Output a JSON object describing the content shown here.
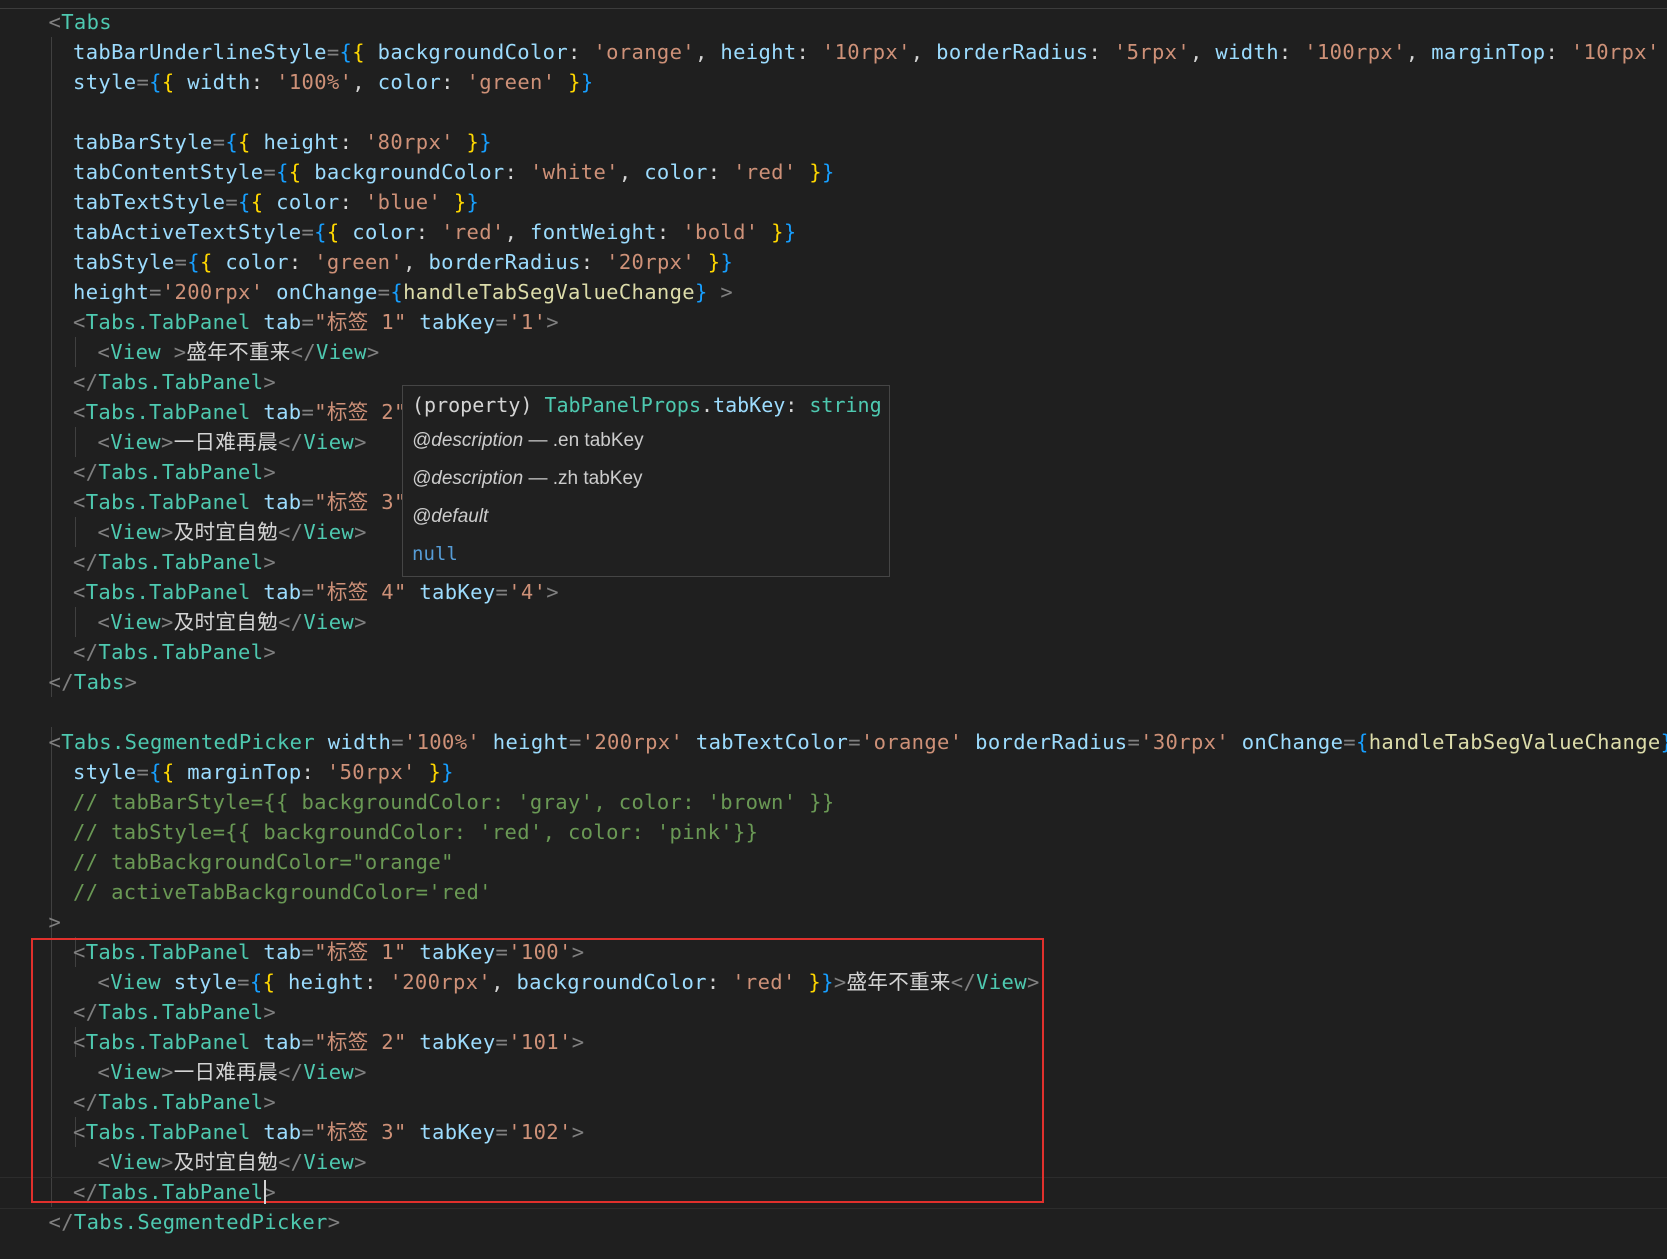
{
  "editor": {
    "lines": [
      [
        [
          "punct",
          "<"
        ],
        [
          "tag",
          "Tabs"
        ]
      ],
      [
        [
          "attr",
          "tabBarUnderlineStyle"
        ],
        [
          "punct",
          "="
        ],
        [
          "brace3",
          "{"
        ],
        [
          "brace",
          "{"
        ],
        [
          "plain",
          " "
        ],
        [
          "attr",
          "backgroundColor"
        ],
        [
          "plain",
          ": "
        ],
        [
          "str",
          "'orange'"
        ],
        [
          "plain",
          ", "
        ],
        [
          "attr",
          "height"
        ],
        [
          "plain",
          ": "
        ],
        [
          "str",
          "'10rpx'"
        ],
        [
          "plain",
          ", "
        ],
        [
          "attr",
          "borderRadius"
        ],
        [
          "plain",
          ": "
        ],
        [
          "str",
          "'5rpx'"
        ],
        [
          "plain",
          ", "
        ],
        [
          "attr",
          "width"
        ],
        [
          "plain",
          ": "
        ],
        [
          "str",
          "'100rpx'"
        ],
        [
          "plain",
          ", "
        ],
        [
          "attr",
          "marginTop"
        ],
        [
          "plain",
          ": "
        ],
        [
          "str",
          "'10rpx'"
        ],
        [
          "plain",
          " "
        ],
        [
          "brace",
          "}"
        ],
        [
          "brace3",
          "}"
        ]
      ],
      [
        [
          "attr",
          "style"
        ],
        [
          "punct",
          "="
        ],
        [
          "brace3",
          "{"
        ],
        [
          "brace",
          "{"
        ],
        [
          "plain",
          " "
        ],
        [
          "attr",
          "width"
        ],
        [
          "plain",
          ": "
        ],
        [
          "str",
          "'100%'"
        ],
        [
          "plain",
          ", "
        ],
        [
          "attr",
          "color"
        ],
        [
          "plain",
          ": "
        ],
        [
          "str",
          "'green'"
        ],
        [
          "plain",
          " "
        ],
        [
          "brace",
          "}"
        ],
        [
          "brace3",
          "}"
        ]
      ],
      [],
      [
        [
          "attr",
          "tabBarStyle"
        ],
        [
          "punct",
          "="
        ],
        [
          "brace3",
          "{"
        ],
        [
          "brace",
          "{"
        ],
        [
          "plain",
          " "
        ],
        [
          "attr",
          "height"
        ],
        [
          "plain",
          ": "
        ],
        [
          "str",
          "'80rpx'"
        ],
        [
          "plain",
          " "
        ],
        [
          "brace",
          "}"
        ],
        [
          "brace3",
          "}"
        ]
      ],
      [
        [
          "attr",
          "tabContentStyle"
        ],
        [
          "punct",
          "="
        ],
        [
          "brace3",
          "{"
        ],
        [
          "brace",
          "{"
        ],
        [
          "plain",
          " "
        ],
        [
          "attr",
          "backgroundColor"
        ],
        [
          "plain",
          ": "
        ],
        [
          "str",
          "'white'"
        ],
        [
          "plain",
          ", "
        ],
        [
          "attr",
          "color"
        ],
        [
          "plain",
          ": "
        ],
        [
          "str",
          "'red'"
        ],
        [
          "plain",
          " "
        ],
        [
          "brace",
          "}"
        ],
        [
          "brace3",
          "}"
        ]
      ],
      [
        [
          "attr",
          "tabTextStyle"
        ],
        [
          "punct",
          "="
        ],
        [
          "brace3",
          "{"
        ],
        [
          "brace",
          "{"
        ],
        [
          "plain",
          " "
        ],
        [
          "attr",
          "color"
        ],
        [
          "plain",
          ": "
        ],
        [
          "str",
          "'blue'"
        ],
        [
          "plain",
          " "
        ],
        [
          "brace",
          "}"
        ],
        [
          "brace3",
          "}"
        ]
      ],
      [
        [
          "attr",
          "tabActiveTextStyle"
        ],
        [
          "punct",
          "="
        ],
        [
          "brace3",
          "{"
        ],
        [
          "brace",
          "{"
        ],
        [
          "plain",
          " "
        ],
        [
          "attr",
          "color"
        ],
        [
          "plain",
          ": "
        ],
        [
          "str",
          "'red'"
        ],
        [
          "plain",
          ", "
        ],
        [
          "attr",
          "fontWeight"
        ],
        [
          "plain",
          ": "
        ],
        [
          "str",
          "'bold'"
        ],
        [
          "plain",
          " "
        ],
        [
          "brace",
          "}"
        ],
        [
          "brace3",
          "}"
        ]
      ],
      [
        [
          "attr",
          "tabStyle"
        ],
        [
          "punct",
          "="
        ],
        [
          "brace3",
          "{"
        ],
        [
          "brace",
          "{"
        ],
        [
          "plain",
          " "
        ],
        [
          "attr",
          "color"
        ],
        [
          "plain",
          ": "
        ],
        [
          "str",
          "'green'"
        ],
        [
          "plain",
          ", "
        ],
        [
          "attr",
          "borderRadius"
        ],
        [
          "plain",
          ": "
        ],
        [
          "str",
          "'20rpx'"
        ],
        [
          "plain",
          " "
        ],
        [
          "brace",
          "}"
        ],
        [
          "brace3",
          "}"
        ]
      ],
      [
        [
          "attr",
          "height"
        ],
        [
          "punct",
          "="
        ],
        [
          "str",
          "'200rpx'"
        ],
        [
          "plain",
          " "
        ],
        [
          "attr",
          "onChange"
        ],
        [
          "punct",
          "="
        ],
        [
          "brace3",
          "{"
        ],
        [
          "fn",
          "handleTabSegValueChange"
        ],
        [
          "brace3",
          "}"
        ],
        [
          "plain",
          " "
        ],
        [
          "punct",
          ">"
        ]
      ],
      [
        [
          "punct",
          "<"
        ],
        [
          "tag",
          "Tabs.TabPanel"
        ],
        [
          "plain",
          " "
        ],
        [
          "attr",
          "tab"
        ],
        [
          "punct",
          "="
        ],
        [
          "str",
          "\"标签 1\""
        ],
        [
          "plain",
          " "
        ],
        [
          "attr",
          "tabKey"
        ],
        [
          "punct",
          "="
        ],
        [
          "str",
          "'1'"
        ],
        [
          "punct",
          ">"
        ]
      ],
      [
        [
          "punct",
          "<"
        ],
        [
          "tag",
          "View"
        ],
        [
          "plain",
          " "
        ],
        [
          "punct",
          ">"
        ],
        [
          "text",
          "盛年不重来"
        ],
        [
          "punct",
          "</"
        ],
        [
          "tag",
          "View"
        ],
        [
          "punct",
          ">"
        ]
      ],
      [
        [
          "punct",
          "</"
        ],
        [
          "tag",
          "Tabs.TabPanel"
        ],
        [
          "punct",
          ">"
        ]
      ],
      [
        [
          "punct",
          "<"
        ],
        [
          "tag",
          "Tabs.TabPanel"
        ],
        [
          "plain",
          " "
        ],
        [
          "attr",
          "tab"
        ],
        [
          "punct",
          "="
        ],
        [
          "str",
          "\"标签 2\""
        ]
      ],
      [
        [
          "punct",
          "<"
        ],
        [
          "tag",
          "View"
        ],
        [
          "punct",
          ">"
        ],
        [
          "text",
          "一日难再晨"
        ],
        [
          "punct",
          "</"
        ],
        [
          "tag",
          "View"
        ],
        [
          "punct",
          ">"
        ]
      ],
      [
        [
          "punct",
          "</"
        ],
        [
          "tag",
          "Tabs.TabPanel"
        ],
        [
          "punct",
          ">"
        ]
      ],
      [
        [
          "punct",
          "<"
        ],
        [
          "tag",
          "Tabs.TabPanel"
        ],
        [
          "plain",
          " "
        ],
        [
          "attr",
          "tab"
        ],
        [
          "punct",
          "="
        ],
        [
          "str",
          "\"标签 3\""
        ]
      ],
      [
        [
          "punct",
          "<"
        ],
        [
          "tag",
          "View"
        ],
        [
          "punct",
          ">"
        ],
        [
          "text",
          "及时宜自勉"
        ],
        [
          "punct",
          "</"
        ],
        [
          "tag",
          "View"
        ],
        [
          "punct",
          ">"
        ]
      ],
      [
        [
          "punct",
          "</"
        ],
        [
          "tag",
          "Tabs.TabPanel"
        ],
        [
          "punct",
          ">"
        ]
      ],
      [
        [
          "punct",
          "<"
        ],
        [
          "tag",
          "Tabs.TabPanel"
        ],
        [
          "plain",
          " "
        ],
        [
          "attr",
          "tab"
        ],
        [
          "punct",
          "="
        ],
        [
          "str",
          "\"标签 4\""
        ],
        [
          "plain",
          " "
        ],
        [
          "attr",
          "tabKey"
        ],
        [
          "punct",
          "="
        ],
        [
          "str",
          "'4'"
        ],
        [
          "punct",
          ">"
        ]
      ],
      [
        [
          "punct",
          "<"
        ],
        [
          "tag",
          "View"
        ],
        [
          "punct",
          ">"
        ],
        [
          "text",
          "及时宜自勉"
        ],
        [
          "punct",
          "</"
        ],
        [
          "tag",
          "View"
        ],
        [
          "punct",
          ">"
        ]
      ],
      [
        [
          "punct",
          "</"
        ],
        [
          "tag",
          "Tabs.TabPanel"
        ],
        [
          "punct",
          ">"
        ]
      ],
      [
        [
          "punct",
          "</"
        ],
        [
          "tag",
          "Tabs"
        ],
        [
          "punct",
          ">"
        ]
      ],
      [],
      [
        [
          "punct",
          "<"
        ],
        [
          "tag",
          "Tabs.SegmentedPicker"
        ],
        [
          "plain",
          " "
        ],
        [
          "attr",
          "width"
        ],
        [
          "punct",
          "="
        ],
        [
          "str",
          "'100%'"
        ],
        [
          "plain",
          " "
        ],
        [
          "attr",
          "height"
        ],
        [
          "punct",
          "="
        ],
        [
          "str",
          "'200rpx'"
        ],
        [
          "plain",
          " "
        ],
        [
          "attr",
          "tabTextColor"
        ],
        [
          "punct",
          "="
        ],
        [
          "str",
          "'orange'"
        ],
        [
          "plain",
          " "
        ],
        [
          "attr",
          "borderRadius"
        ],
        [
          "punct",
          "="
        ],
        [
          "str",
          "'30rpx'"
        ],
        [
          "plain",
          " "
        ],
        [
          "attr",
          "onChange"
        ],
        [
          "punct",
          "="
        ],
        [
          "brace3",
          "{"
        ],
        [
          "fn",
          "handleTabSegValueChange"
        ],
        [
          "brace3",
          "}"
        ]
      ],
      [
        [
          "attr",
          "style"
        ],
        [
          "punct",
          "="
        ],
        [
          "brace3",
          "{"
        ],
        [
          "brace",
          "{"
        ],
        [
          "plain",
          " "
        ],
        [
          "attr",
          "marginTop"
        ],
        [
          "plain",
          ": "
        ],
        [
          "str",
          "'50rpx'"
        ],
        [
          "plain",
          " "
        ],
        [
          "brace",
          "}"
        ],
        [
          "brace3",
          "}"
        ]
      ],
      [
        [
          "comment",
          "// tabBarStyle={{ backgroundColor: 'gray', color: 'brown' }}"
        ]
      ],
      [
        [
          "comment",
          "// tabStyle={{ backgroundColor: 'red', color: 'pink'}}"
        ]
      ],
      [
        [
          "comment",
          "// tabBackgroundColor=\"orange\""
        ]
      ],
      [
        [
          "comment",
          "// activeTabBackgroundColor='red'"
        ]
      ],
      [
        [
          "punct",
          ">"
        ]
      ],
      [
        [
          "punct",
          "<"
        ],
        [
          "tag",
          "Tabs.TabPanel"
        ],
        [
          "plain",
          " "
        ],
        [
          "attr",
          "tab"
        ],
        [
          "punct",
          "="
        ],
        [
          "str",
          "\"标签 1\""
        ],
        [
          "plain",
          " "
        ],
        [
          "attr",
          "tabKey"
        ],
        [
          "punct",
          "="
        ],
        [
          "str",
          "'100'"
        ],
        [
          "punct",
          ">"
        ]
      ],
      [
        [
          "punct",
          "<"
        ],
        [
          "tag",
          "View"
        ],
        [
          "plain",
          " "
        ],
        [
          "attr",
          "style"
        ],
        [
          "punct",
          "="
        ],
        [
          "brace3",
          "{"
        ],
        [
          "brace",
          "{"
        ],
        [
          "plain",
          " "
        ],
        [
          "attr",
          "height"
        ],
        [
          "plain",
          ": "
        ],
        [
          "str",
          "'200rpx'"
        ],
        [
          "plain",
          ", "
        ],
        [
          "attr",
          "backgroundColor"
        ],
        [
          "plain",
          ": "
        ],
        [
          "str",
          "'red'"
        ],
        [
          "plain",
          " "
        ],
        [
          "brace",
          "}"
        ],
        [
          "brace3",
          "}"
        ],
        [
          "punct",
          ">"
        ],
        [
          "text",
          "盛年不重来"
        ],
        [
          "punct",
          "</"
        ],
        [
          "tag",
          "View"
        ],
        [
          "punct",
          ">"
        ]
      ],
      [
        [
          "punct",
          "</"
        ],
        [
          "tag",
          "Tabs.TabPanel"
        ],
        [
          "punct",
          ">"
        ]
      ],
      [
        [
          "punct",
          "<"
        ],
        [
          "tag",
          "Tabs.TabPanel"
        ],
        [
          "plain",
          " "
        ],
        [
          "attr",
          "tab"
        ],
        [
          "punct",
          "="
        ],
        [
          "str",
          "\"标签 2\""
        ],
        [
          "plain",
          " "
        ],
        [
          "attr",
          "tabKey"
        ],
        [
          "punct",
          "="
        ],
        [
          "str",
          "'101'"
        ],
        [
          "punct",
          ">"
        ]
      ],
      [
        [
          "punct",
          "<"
        ],
        [
          "tag",
          "View"
        ],
        [
          "punct",
          ">"
        ],
        [
          "text",
          "一日难再晨"
        ],
        [
          "punct",
          "</"
        ],
        [
          "tag",
          "View"
        ],
        [
          "punct",
          ">"
        ]
      ],
      [
        [
          "punct",
          "</"
        ],
        [
          "tag",
          "Tabs.TabPanel"
        ],
        [
          "punct",
          ">"
        ]
      ],
      [
        [
          "punct",
          "<"
        ],
        [
          "tag",
          "Tabs.TabPanel"
        ],
        [
          "plain",
          " "
        ],
        [
          "attr",
          "tab"
        ],
        [
          "punct",
          "="
        ],
        [
          "str",
          "\"标签 3\""
        ],
        [
          "plain",
          " "
        ],
        [
          "attr",
          "tabKey"
        ],
        [
          "punct",
          "="
        ],
        [
          "str",
          "'102'"
        ],
        [
          "punct",
          ">"
        ]
      ],
      [
        [
          "punct",
          "<"
        ],
        [
          "tag",
          "View"
        ],
        [
          "punct",
          ">"
        ],
        [
          "text",
          "及时宜自勉"
        ],
        [
          "punct",
          "</"
        ],
        [
          "tag",
          "View"
        ],
        [
          "punct",
          ">"
        ]
      ],
      [
        [
          "punct",
          "</"
        ],
        [
          "tag",
          "Tabs.TabPanel"
        ],
        [
          "punct",
          ">"
        ]
      ],
      [
        [
          "punct",
          "</"
        ],
        [
          "tag",
          "Tabs.SegmentedPicker"
        ],
        [
          "punct",
          ">"
        ]
      ]
    ]
  },
  "hover": {
    "signature": [
      [
        "keyword",
        "(property) "
      ],
      [
        "type",
        "TabPanelProps"
      ],
      [
        "keyword",
        "."
      ],
      [
        "prop",
        "tabKey"
      ],
      [
        "keyword",
        ": "
      ],
      [
        "tp",
        "string"
      ]
    ],
    "desc_en_tag": "@description",
    "desc_en_text": " — .en tabKey",
    "desc_zh_tag": "@description",
    "desc_zh_text": " — .zh tabKey",
    "default_tag": "@default",
    "default_value": "null"
  },
  "colors": {
    "background": "#1f1f1f",
    "highlight_border": "#e0302c",
    "tag": "#4ec9b0",
    "attribute": "#9cdcfe",
    "string": "#ce9178",
    "comment": "#6a9955"
  }
}
